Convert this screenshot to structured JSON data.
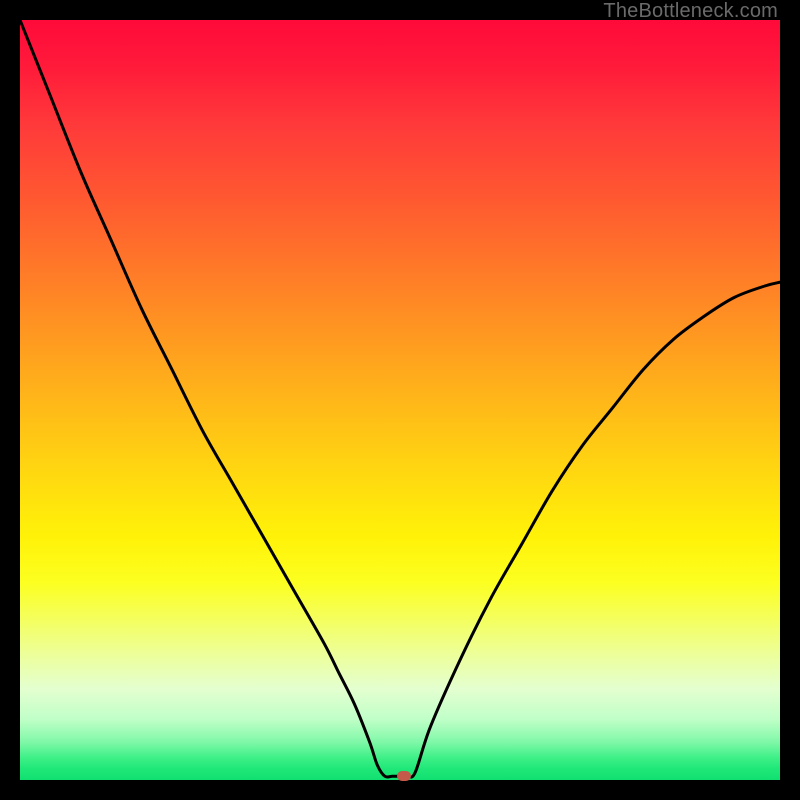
{
  "watermark": "TheBottleneck.com",
  "colors": {
    "curve": "#000000",
    "marker": "#c35a4a",
    "frame": "#000000"
  },
  "chart_data": {
    "type": "line",
    "title": "",
    "xlabel": "",
    "ylabel": "",
    "xlim": [
      0,
      100
    ],
    "ylim": [
      0,
      100
    ],
    "x": [
      0,
      4,
      8,
      12,
      16,
      20,
      24,
      28,
      32,
      36,
      40,
      42,
      44,
      46,
      47,
      48,
      49,
      50,
      51,
      52,
      54,
      58,
      62,
      66,
      70,
      74,
      78,
      82,
      86,
      90,
      94,
      98,
      100
    ],
    "y": [
      100,
      90,
      80,
      71,
      62,
      54,
      46,
      39,
      32,
      25,
      18,
      14,
      10,
      5,
      2,
      0.5,
      0.5,
      0.5,
      0.5,
      1,
      7,
      16,
      24,
      31,
      38,
      44,
      49,
      54,
      58,
      61,
      63.5,
      65,
      65.5
    ],
    "marker": {
      "x": 50.5,
      "y": 0.5
    },
    "grid": false,
    "legend": false,
    "background_gradient": {
      "type": "vertical",
      "stops": [
        {
          "pos": 0.0,
          "color": "#ff0a3a"
        },
        {
          "pos": 0.5,
          "color": "#ffd000"
        },
        {
          "pos": 0.85,
          "color": "#f8ff80"
        },
        {
          "pos": 1.0,
          "color": "#10e070"
        }
      ]
    }
  }
}
